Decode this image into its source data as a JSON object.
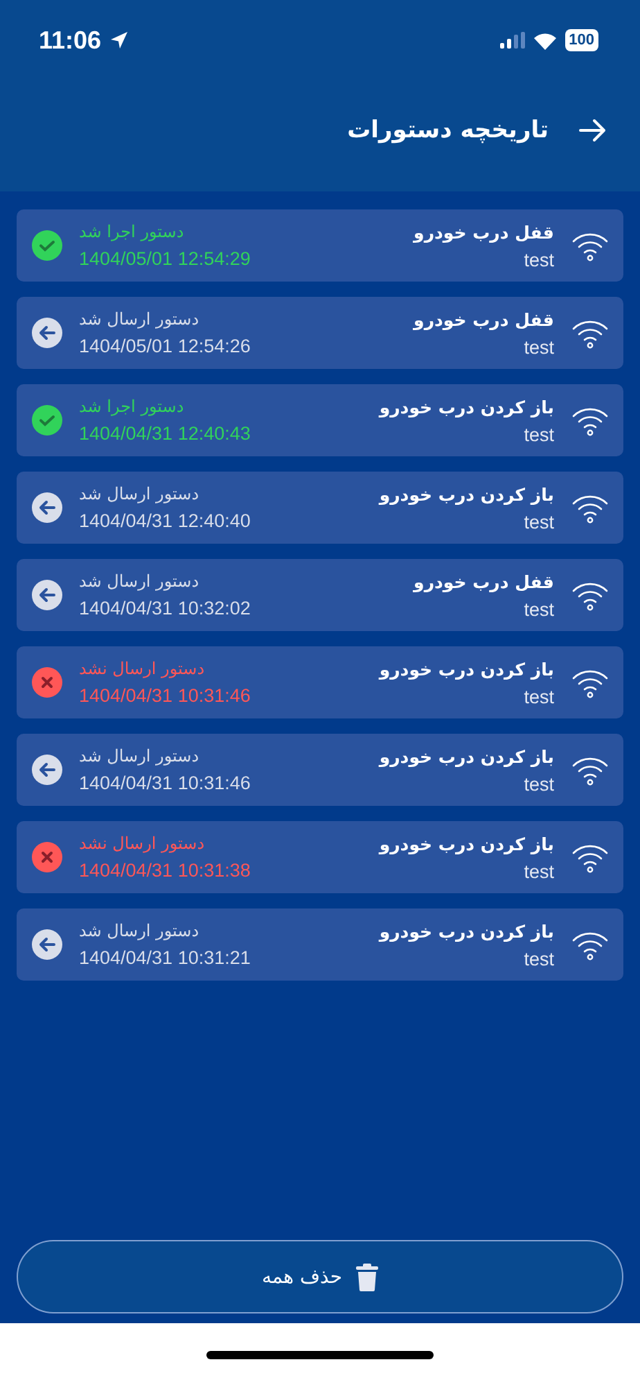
{
  "status_bar": {
    "time": "11:06",
    "battery": "100"
  },
  "header": {
    "title": "تاریخچه دستورات"
  },
  "commands": [
    {
      "title": "قفل درب خودرو",
      "subtitle": "test",
      "status": "دستور اجرا شد",
      "time": "1404/05/01 12:54:29",
      "kind": "executed"
    },
    {
      "title": "قفل درب خودرو",
      "subtitle": "test",
      "status": "دستور ارسال شد",
      "time": "1404/05/01 12:54:26",
      "kind": "sent"
    },
    {
      "title": "باز کردن درب خودرو",
      "subtitle": "test",
      "status": "دستور اجرا شد",
      "time": "1404/04/31 12:40:43",
      "kind": "executed"
    },
    {
      "title": "باز کردن درب خودرو",
      "subtitle": "test",
      "status": "دستور ارسال شد",
      "time": "1404/04/31 12:40:40",
      "kind": "sent"
    },
    {
      "title": "قفل درب خودرو",
      "subtitle": "test",
      "status": "دستور ارسال شد",
      "time": "1404/04/31 10:32:02",
      "kind": "sent"
    },
    {
      "title": "باز کردن درب خودرو",
      "subtitle": "test",
      "status": "دستور ارسال نشد",
      "time": "1404/04/31 10:31:46",
      "kind": "failed"
    },
    {
      "title": "باز کردن درب خودرو",
      "subtitle": "test",
      "status": "دستور ارسال شد",
      "time": "1404/04/31 10:31:46",
      "kind": "sent"
    },
    {
      "title": "باز کردن درب خودرو",
      "subtitle": "test",
      "status": "دستور ارسال نشد",
      "time": "1404/04/31 10:31:38",
      "kind": "failed"
    },
    {
      "title": "باز کردن درب خودرو",
      "subtitle": "test",
      "status": "دستور ارسال شد",
      "time": "1404/04/31 10:31:21",
      "kind": "sent"
    }
  ],
  "delete_all_button": {
    "label": "حذف همه"
  }
}
